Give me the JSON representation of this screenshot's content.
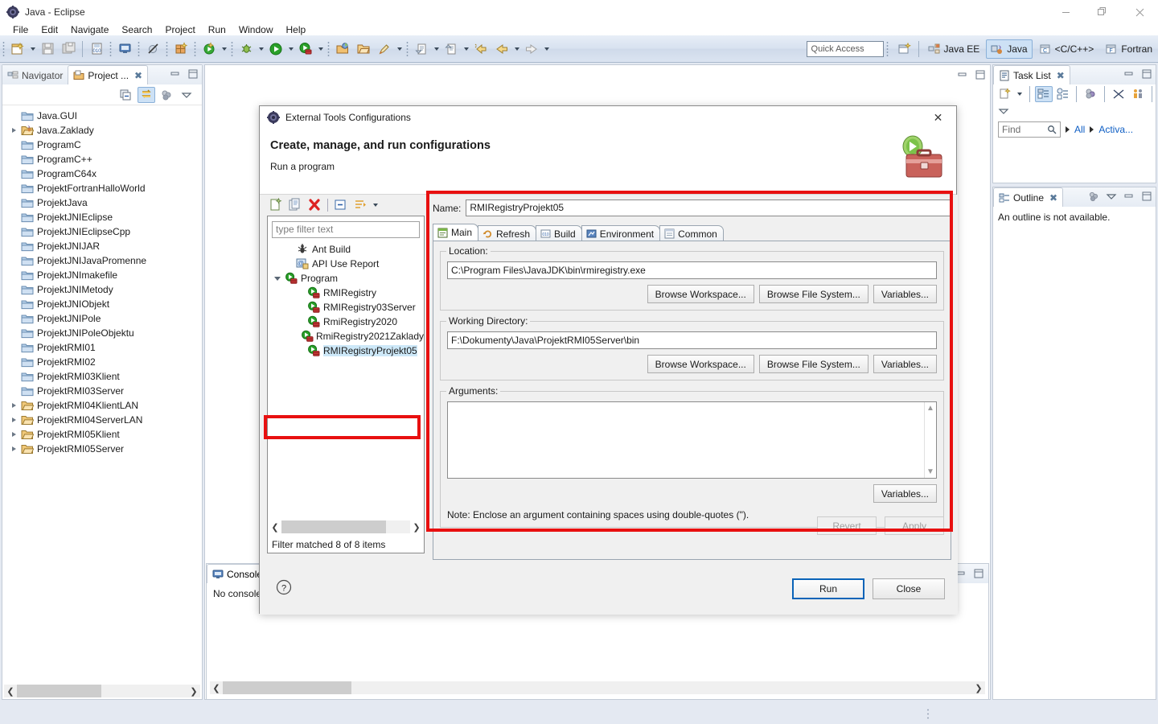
{
  "window": {
    "title": "Java - Eclipse",
    "app_icon": "eclipse-icon",
    "minimize": "—",
    "maximize": "❐",
    "close": "✕"
  },
  "menubar": {
    "items": [
      {
        "label": "File"
      },
      {
        "label": "Edit"
      },
      {
        "label": "Navigate"
      },
      {
        "label": "Search"
      },
      {
        "label": "Project"
      },
      {
        "label": "Run"
      },
      {
        "label": "Window"
      },
      {
        "label": "Help"
      }
    ]
  },
  "toolbar": {
    "quick_access_placeholder": "Quick Access",
    "perspectives": [
      {
        "label": "Java EE",
        "active": false
      },
      {
        "label": "Java",
        "active": true
      },
      {
        "label": "<C/C++>",
        "active": false
      },
      {
        "label": "Fortran",
        "active": false
      }
    ]
  },
  "left_view": {
    "tabs": [
      {
        "label": "Navigator",
        "active": false
      },
      {
        "label": "Project ...",
        "active": true
      }
    ],
    "close_glyph": "✖",
    "tree": [
      {
        "label": "Java.GUI",
        "icon": "folder-icon",
        "expandable": false,
        "indent": 1
      },
      {
        "label": "Java.Zaklady",
        "icon": "java-project-icon",
        "expandable": true,
        "indent": 1
      },
      {
        "label": "ProgramC",
        "icon": "folder-icon",
        "expandable": false,
        "indent": 1
      },
      {
        "label": "ProgramC++",
        "icon": "folder-icon",
        "expandable": false,
        "indent": 1
      },
      {
        "label": "ProgramC64x",
        "icon": "folder-icon",
        "expandable": false,
        "indent": 1
      },
      {
        "label": "ProjektFortranHalloWorld",
        "icon": "folder-icon",
        "expandable": false,
        "indent": 1
      },
      {
        "label": "ProjektJava",
        "icon": "folder-icon",
        "expandable": false,
        "indent": 1
      },
      {
        "label": "ProjektJNIEclipse",
        "icon": "folder-icon",
        "expandable": false,
        "indent": 1
      },
      {
        "label": "ProjektJNIEclipseCpp",
        "icon": "folder-icon",
        "expandable": false,
        "indent": 1
      },
      {
        "label": "ProjektJNIJAR",
        "icon": "folder-icon",
        "expandable": false,
        "indent": 1
      },
      {
        "label": "ProjektJNIJavaPromenne",
        "icon": "folder-icon",
        "expandable": false,
        "indent": 1
      },
      {
        "label": "ProjektJNImakefile",
        "icon": "folder-icon",
        "expandable": false,
        "indent": 1
      },
      {
        "label": "ProjektJNIMetody",
        "icon": "folder-icon",
        "expandable": false,
        "indent": 1
      },
      {
        "label": "ProjektJNIObjekt",
        "icon": "folder-icon",
        "expandable": false,
        "indent": 1
      },
      {
        "label": "ProjektJNIPole",
        "icon": "folder-icon",
        "expandable": false,
        "indent": 1
      },
      {
        "label": "ProjektJNIPoleObjektu",
        "icon": "folder-icon",
        "expandable": false,
        "indent": 1
      },
      {
        "label": "ProjektRMI01",
        "icon": "folder-icon",
        "expandable": false,
        "indent": 1
      },
      {
        "label": "ProjektRMI02",
        "icon": "folder-icon",
        "expandable": false,
        "indent": 1
      },
      {
        "label": "ProjektRMI03Klient",
        "icon": "folder-icon",
        "expandable": false,
        "indent": 1
      },
      {
        "label": "ProjektRMI03Server",
        "icon": "folder-icon",
        "expandable": false,
        "indent": 1
      },
      {
        "label": "ProjektRMI04KlientLAN",
        "icon": "open-folder-icon",
        "expandable": true,
        "indent": 1
      },
      {
        "label": "ProjektRMI04ServerLAN",
        "icon": "open-folder-icon",
        "expandable": true,
        "indent": 1
      },
      {
        "label": "ProjektRMI05Klient",
        "icon": "open-folder-icon",
        "expandable": true,
        "indent": 1
      },
      {
        "label": "ProjektRMI05Server",
        "icon": "open-folder-icon",
        "expandable": true,
        "indent": 1
      }
    ]
  },
  "console_view": {
    "tab_label": "Console",
    "message": "No consoles"
  },
  "task_list": {
    "tab_label": "Task List",
    "find_placeholder": "Find",
    "all_label": "All",
    "activate_label": "Activa..."
  },
  "outline": {
    "tab_label": "Outline",
    "message": "An outline is not available."
  },
  "dialog": {
    "title": "External Tools Configurations",
    "heading": "Create, manage, and run configurations",
    "subheading": "Run a program",
    "close_glyph": "✕",
    "filter_placeholder": "type filter text",
    "tree": [
      {
        "label": "Ant Build",
        "icon": "ant-build-icon",
        "indent": 1,
        "expandable": false,
        "selected": false
      },
      {
        "label": "API Use Report",
        "icon": "api-use-report-icon",
        "indent": 1,
        "expandable": false,
        "selected": false
      },
      {
        "label": "Program",
        "icon": "program-icon",
        "indent": 0,
        "expandable": true,
        "selected": false
      },
      {
        "label": "RMIRegistry",
        "icon": "program-icon",
        "indent": 2,
        "expandable": false,
        "selected": false
      },
      {
        "label": "RMIRegistry03Server",
        "icon": "program-icon",
        "indent": 2,
        "expandable": false,
        "selected": false
      },
      {
        "label": "RmiRegistry2020",
        "icon": "program-icon",
        "indent": 2,
        "expandable": false,
        "selected": false
      },
      {
        "label": "RmiRegistry2021Zaklady",
        "icon": "program-icon",
        "indent": 2,
        "expandable": false,
        "selected": false
      },
      {
        "label": "RMIRegistryProjekt05",
        "icon": "program-icon",
        "indent": 2,
        "expandable": false,
        "selected": true
      }
    ],
    "filter_status": "Filter matched 8 of 8 items",
    "name_label": "Name:",
    "name_value": "RMIRegistryProjekt05",
    "tabs": [
      {
        "label": "Main",
        "icon": "main-tab-icon",
        "active": true
      },
      {
        "label": "Refresh",
        "icon": "refresh-tab-icon",
        "active": false
      },
      {
        "label": "Build",
        "icon": "build-tab-icon",
        "active": false
      },
      {
        "label": "Environment",
        "icon": "environment-tab-icon",
        "active": false
      },
      {
        "label": "Common",
        "icon": "common-tab-icon",
        "active": false
      }
    ],
    "location": {
      "group_label": "Location:",
      "value": "C:\\Program Files\\JavaJDK\\bin\\rmiregistry.exe",
      "buttons": [
        "Browse Workspace...",
        "Browse File System...",
        "Variables..."
      ]
    },
    "working_directory": {
      "group_label": "Working Directory:",
      "value": "F:\\Dokumenty\\Java\\ProjektRMI05Server\\bin",
      "buttons": [
        "Browse Workspace...",
        "Browse File System...",
        "Variables..."
      ]
    },
    "arguments": {
      "group_label": "Arguments:",
      "value": "",
      "variables_button": "Variables...",
      "note": "Note: Enclose an argument containing spaces using double-quotes (\")."
    },
    "revert_button": "Revert",
    "apply_button": "Apply",
    "run_button": "Run",
    "close_button": "Close",
    "help_icon": "help-icon"
  },
  "colors": {
    "annotation_red": "#e81010",
    "selection_blue": "#cde8f8",
    "accent_blue": "#0a63b8"
  }
}
